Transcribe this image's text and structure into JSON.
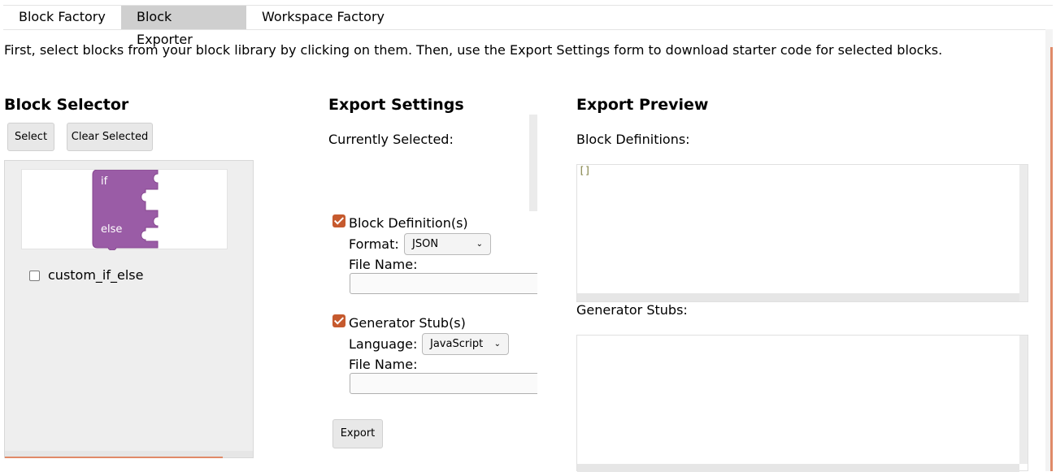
{
  "tabs": [
    {
      "label": "Block Factory"
    },
    {
      "label": "Block Exporter"
    },
    {
      "label": "Workspace Factory"
    }
  ],
  "intro": "First, select blocks from your block library by clicking on them. Then, use the Export Settings form to download starter code for selected blocks.",
  "selector": {
    "title": "Block Selector",
    "select_label": "Select",
    "clear_label": "Clear Selected",
    "block": {
      "if_text": "if",
      "else_text": "else",
      "color": "#9a5ca6"
    },
    "block_name": "custom_if_else"
  },
  "settings": {
    "title": "Export Settings",
    "currently_selected": "Currently Selected:",
    "block_def_label": "Block Definition(s)",
    "format_label": "Format:",
    "format_value": "JSON",
    "file_name_label": "File Name:",
    "generator_label": "Generator Stub(s)",
    "language_label": "Language:",
    "language_value": "JavaScript",
    "file_name_label_2": "File Name:",
    "export_label": "Export",
    "accent": "#c65a2e"
  },
  "preview": {
    "title": "Export Preview",
    "block_defs_label": "Block Definitions:",
    "block_defs_code": "[]",
    "generator_stubs_label": "Generator Stubs:"
  }
}
